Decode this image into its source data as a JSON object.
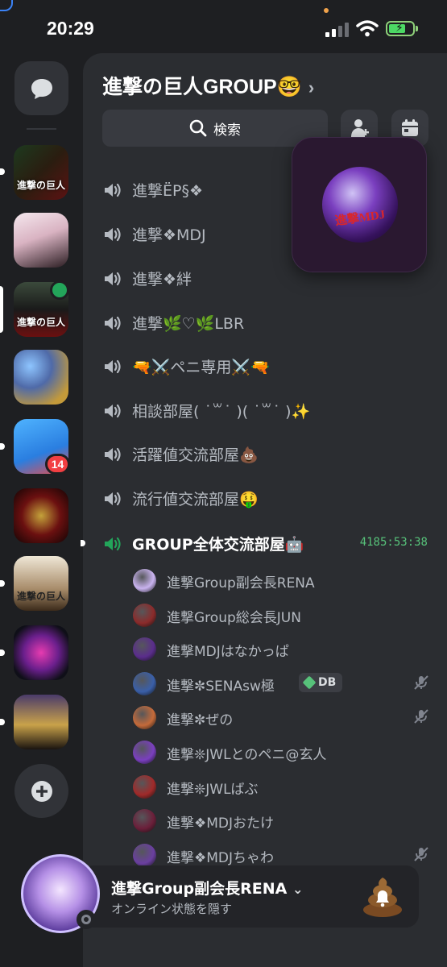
{
  "status_bar": {
    "time": "20:29"
  },
  "server": {
    "name": "進撃の巨人GROUP🤓",
    "chevron": "›",
    "search_label": "検索"
  },
  "rail": {
    "unread_badge": "14",
    "server_labels": [
      "進撃の巨人",
      "進撃の巨人",
      "進撃の巨人"
    ]
  },
  "channels": [
    {
      "name": "進撃ËP§❖"
    },
    {
      "name": "進撃❖MDJ"
    },
    {
      "name": "進撃❖絆"
    },
    {
      "name": "進撃🌿♡🌿LBR"
    },
    {
      "name": "🔫⚔️ペニ専用⚔️🔫"
    },
    {
      "name": "相談部屋( ˙꒳​˙ )( ˙꒳​˙ )✨"
    },
    {
      "name": "活躍値交流部屋💩"
    },
    {
      "name": "流行値交流部屋🤑"
    }
  ],
  "active_voice": {
    "name": "GROUP全体交流部屋🤖",
    "timer": "4185:53:38"
  },
  "members": [
    {
      "name": "進撃Group副会長RENA",
      "muted": false,
      "color": "#c9b3ef"
    },
    {
      "name": "進撃Group総会長JUN",
      "muted": false,
      "color": "#8b2b2b"
    },
    {
      "name": "進撃MDJはなかっぱ",
      "muted": false,
      "color": "#5a2d8c"
    },
    {
      "name": "進撃✼SENAsw極",
      "muted": true,
      "badge": "DB",
      "color": "#3a5fa8"
    },
    {
      "name": "進撃✼ぜの",
      "muted": true,
      "color": "#c46a3a"
    },
    {
      "name": "進撃❊JWLとのペニ@玄人",
      "muted": false,
      "color": "#7a3fbf"
    },
    {
      "name": "進撃❊JWLばぶ",
      "muted": false,
      "color": "#a02a2a"
    },
    {
      "name": "進撃❖MDJおたけ",
      "muted": false,
      "color": "#6b1f3a"
    },
    {
      "name": "進撃❖MDJちゃわ",
      "muted": true,
      "color": "#6a3fa0"
    }
  ],
  "popup": {
    "logo_text": "進撃MDJ"
  },
  "user": {
    "name": "進撃Group副会長RENA",
    "status": "オンライン状態を隠す"
  },
  "colors": {
    "rail_bg": "#1e1f22",
    "panel_bg": "#2b2d31",
    "voice_green": "#23a55a",
    "badge_red": "#f23f42"
  }
}
